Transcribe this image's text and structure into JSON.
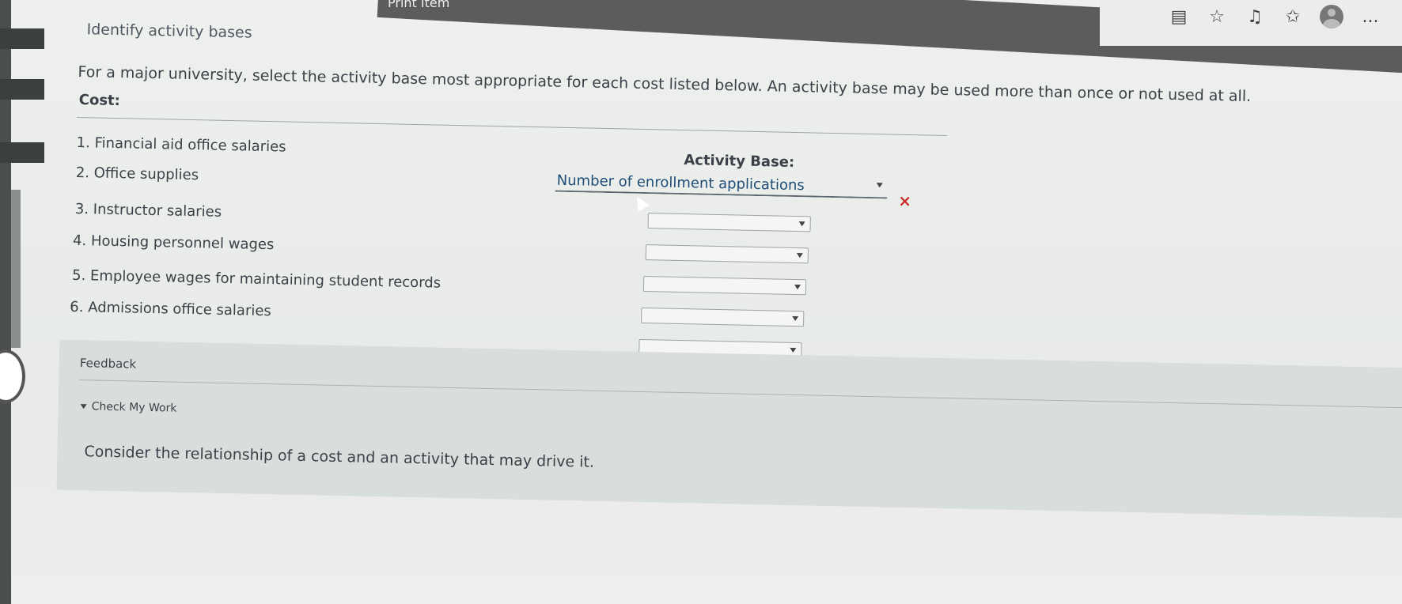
{
  "browser": {
    "tab_label": "Print Item",
    "icons": [
      "reader-icon",
      "star-icon",
      "read-aloud-icon",
      "favorites-icon",
      "profile-avatar",
      "more-icon"
    ],
    "more_label": "..."
  },
  "page": {
    "title": "Identify activity bases",
    "instructions": "For a major university, select the activity base most appropriate for each cost listed below. An activity base may be used more than once or not used at all.",
    "cost_header": "Cost:",
    "activity_header": "Activity Base:"
  },
  "costs": [
    {
      "number": "1.",
      "label": "Financial aid office salaries",
      "selected": "Number of enrollment applications",
      "status": "wrong"
    },
    {
      "number": "2.",
      "label": "Office supplies",
      "selected": ""
    },
    {
      "number": "3.",
      "label": "Instructor salaries",
      "selected": ""
    },
    {
      "number": "4.",
      "label": "Housing personnel wages",
      "selected": ""
    },
    {
      "number": "5.",
      "label": "Employee wages for maintaining student records",
      "selected": ""
    },
    {
      "number": "6.",
      "label": "Admissions office salaries",
      "selected": ""
    }
  ],
  "wrong_mark": "×",
  "feedback": {
    "label": "Feedback",
    "check_my_work": "Check My Work",
    "hint": "Consider the relationship of a cost and an activity that may drive it."
  },
  "colors": {
    "wrong": "#cc2d2d",
    "selected_text": "#1e4d78",
    "feedback_panel": "#d8dedb"
  }
}
